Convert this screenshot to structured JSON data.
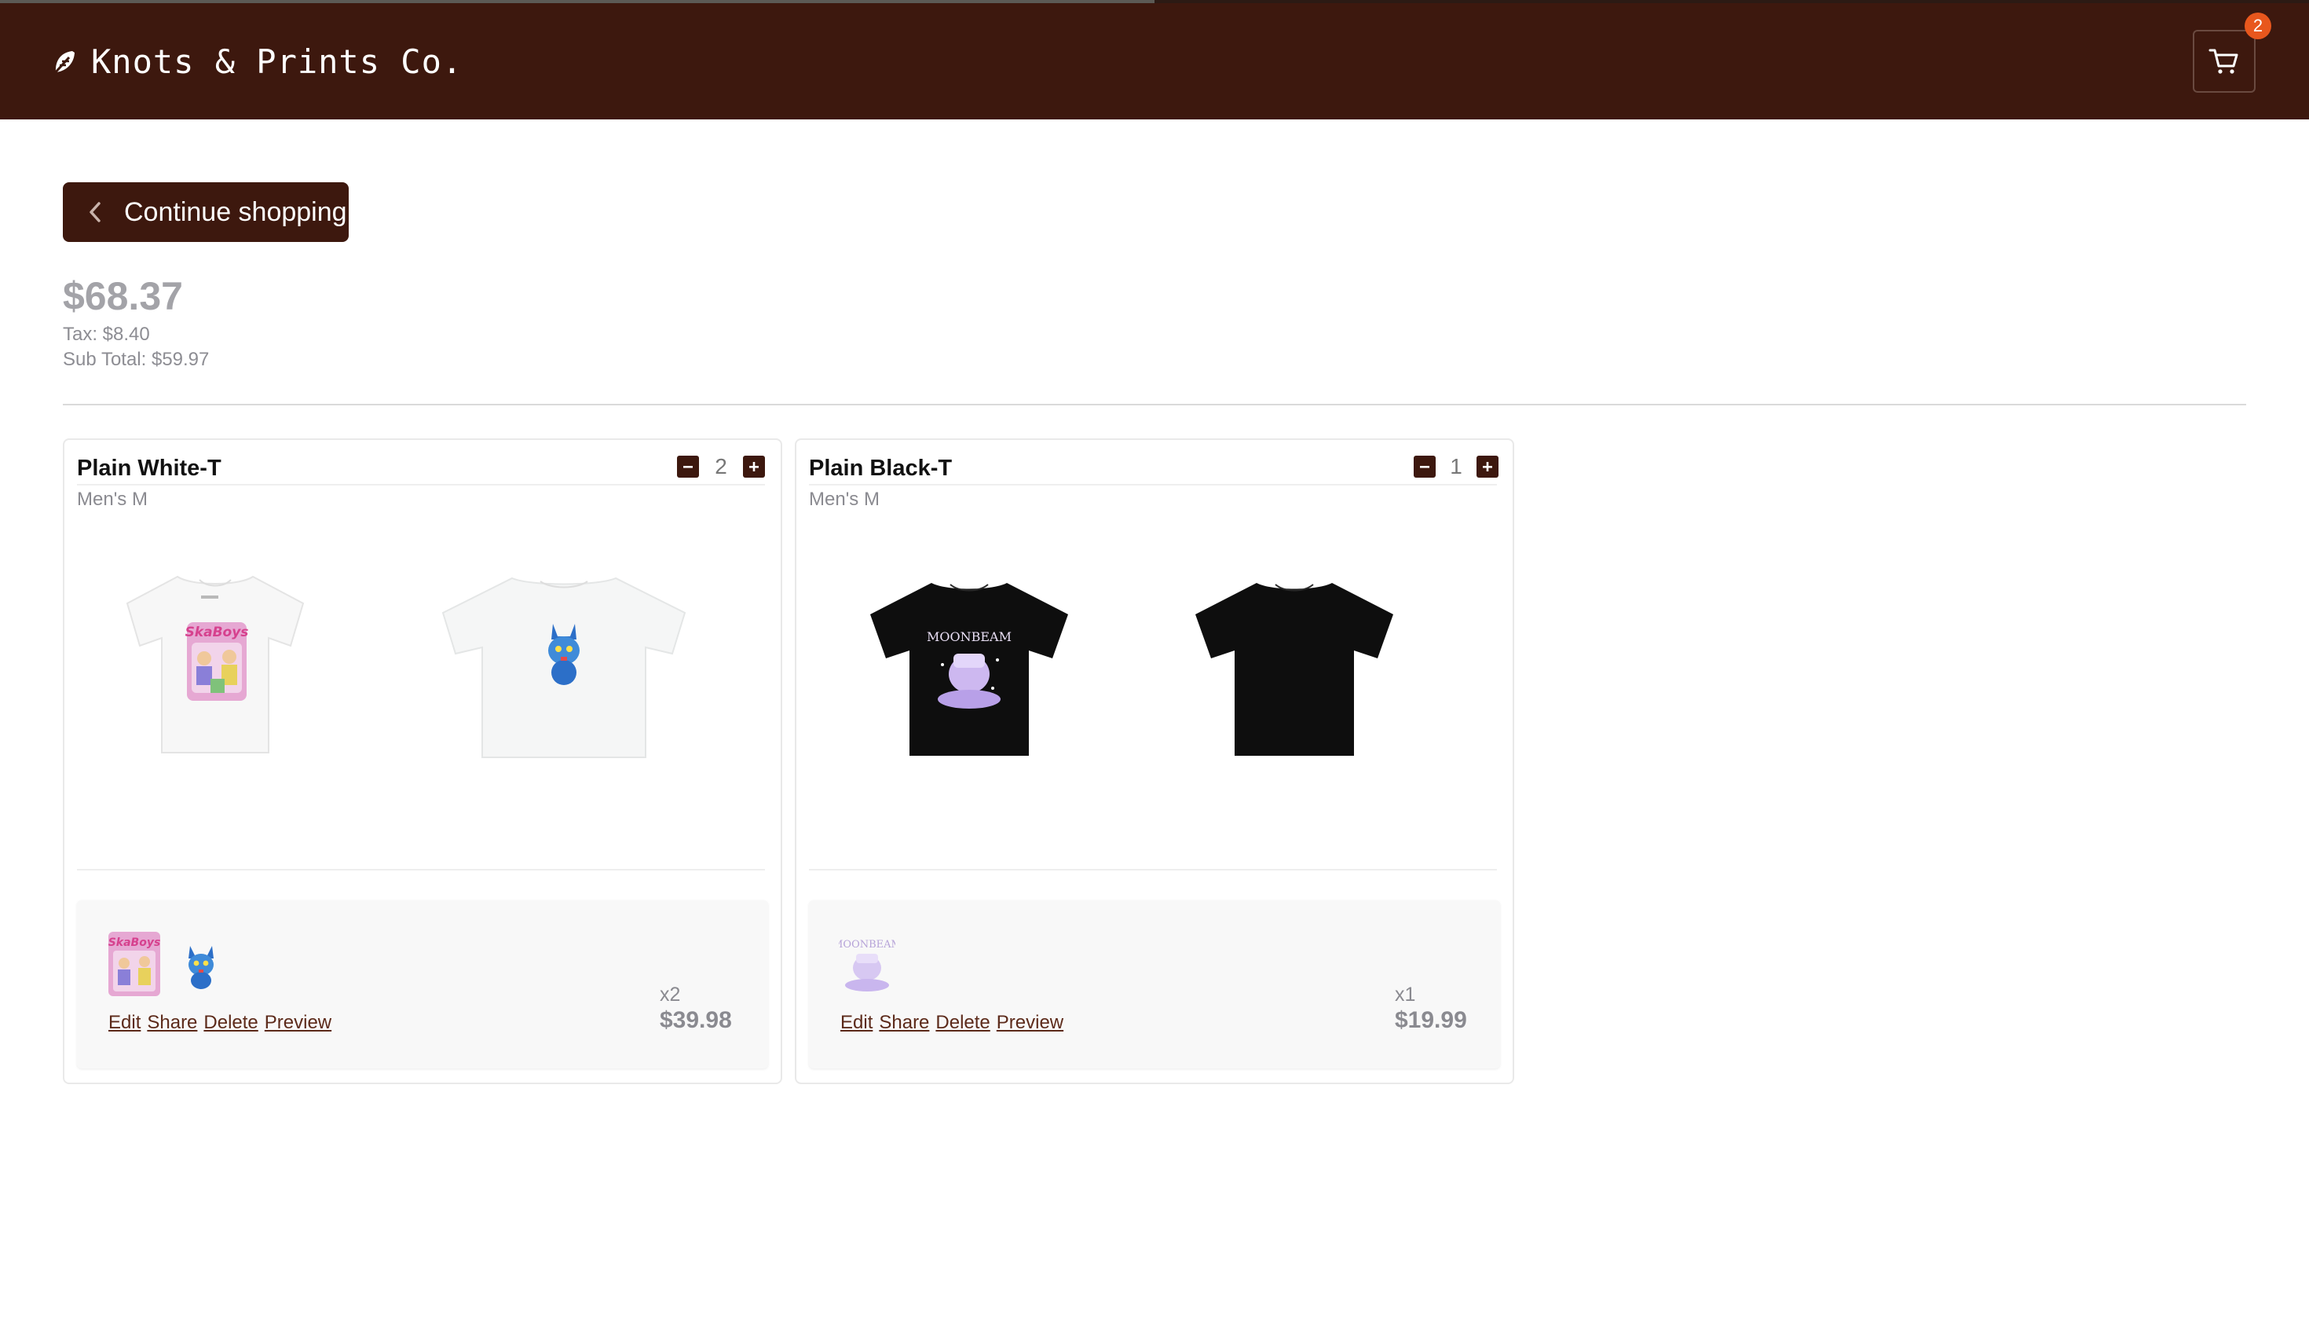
{
  "header": {
    "brand": "Knots & Prints Co.",
    "brand_icon": "feather-icon",
    "cart_icon": "cart-icon",
    "cart_count": "2",
    "brand_color": "#3d180e",
    "badge_color": "#e8571d",
    "progress": 0.5
  },
  "continue_label": "Continue shopping",
  "totals": {
    "total": "$68.37",
    "tax": "Tax: $8.40",
    "subtotal": "Sub Total: $59.97"
  },
  "items": [
    {
      "title": "Plain White-T",
      "variant": "Men's M",
      "quantity": "2",
      "shirt_color": "white",
      "designs": [
        "skaterboys-print",
        "blue-cat-print"
      ],
      "links": {
        "edit": "Edit",
        "share": "Share",
        "delete": "Delete",
        "preview": "Preview"
      },
      "multiplier": "x2",
      "price": "$39.98"
    },
    {
      "title": "Plain Black-T",
      "variant": "Men's M",
      "quantity": "1",
      "shirt_color": "black",
      "designs": [
        "moonbeam-print"
      ],
      "links": {
        "edit": "Edit",
        "share": "Share",
        "delete": "Delete",
        "preview": "Preview"
      },
      "multiplier": "x1",
      "price": "$19.99"
    }
  ]
}
